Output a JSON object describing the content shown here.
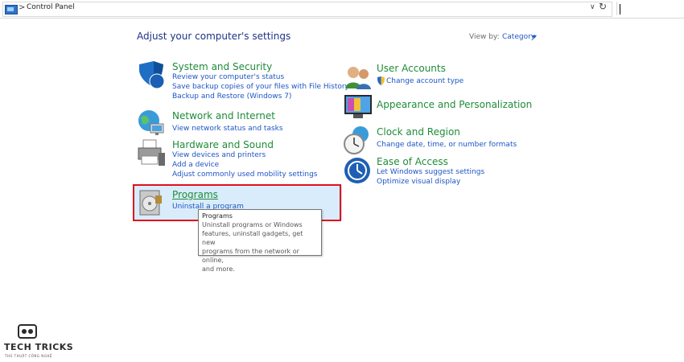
{
  "address_bar": {
    "path": "Control Panel",
    "separator": ">",
    "dropdown_glyph": "∨",
    "refresh_glyph": "↻"
  },
  "main": {
    "heading": "Adjust your computer's settings",
    "view_by_label": "View by:",
    "view_by_value": "Category"
  },
  "categories": {
    "system": {
      "title": "System and Security",
      "links": [
        "Review your computer's status",
        "Save backup copies of your files with File History",
        "Backup and Restore (Windows 7)"
      ]
    },
    "network": {
      "title": "Network and Internet",
      "links": [
        "View network status and tasks"
      ]
    },
    "hardware": {
      "title": "Hardware and Sound",
      "links": [
        "View devices and printers",
        "Add a device",
        "Adjust commonly used mobility settings"
      ]
    },
    "programs": {
      "title": "Programs",
      "links": [
        "Uninstall a program"
      ]
    },
    "accounts": {
      "title": "User Accounts",
      "links": [
        "Change account type"
      ]
    },
    "appearance": {
      "title": "Appearance and Personalization",
      "links": []
    },
    "clock": {
      "title": "Clock and Region",
      "links": [
        "Change date, time, or number formats"
      ]
    },
    "ease": {
      "title": "Ease of Access",
      "links": [
        "Let Windows suggest settings",
        "Optimize visual display"
      ]
    }
  },
  "tooltip": {
    "title": "Programs",
    "lines": [
      "Uninstall programs or Windows",
      "features, uninstall gadgets, get new",
      "programs from the network or online,",
      "and more."
    ]
  },
  "watermark": {
    "name": "TECH TRICKS",
    "tagline": "THỦ THUẬT CÔNG NGHỆ"
  },
  "colors": {
    "category_title": "#1e8c39",
    "link": "#1e56c4",
    "heading": "#1e3287",
    "highlight": "#d9ecfb",
    "annotation_box": "#e0101f"
  },
  "icons": {
    "system": "shield-icon",
    "network": "globe-network-icon",
    "hardware": "printer-icon",
    "programs": "programs-disk-icon",
    "accounts": "users-icon",
    "appearance": "monitor-palette-icon",
    "clock": "clock-globe-icon",
    "ease": "ease-of-access-icon"
  }
}
